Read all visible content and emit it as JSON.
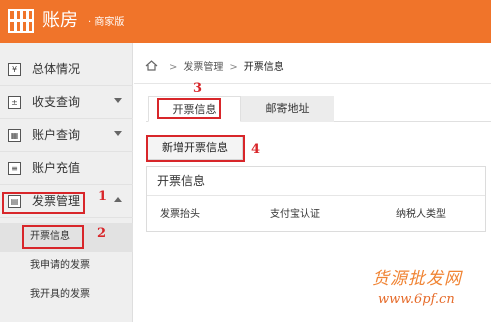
{
  "app": {
    "name": "账房",
    "sub": "· 商家版"
  },
  "sidebar": {
    "items": [
      {
        "label": "总体情况"
      },
      {
        "label": "收支查询"
      },
      {
        "label": "账户查询"
      },
      {
        "label": "账户充值"
      },
      {
        "label": "发票管理"
      }
    ],
    "subitems": [
      {
        "label": "开票信息"
      },
      {
        "label": "我申请的发票"
      },
      {
        "label": "我开具的发票"
      }
    ]
  },
  "breadcrumb": {
    "level1": "发票管理",
    "separator": ">",
    "current": "开票信息"
  },
  "tabs": [
    {
      "label": "开票信息"
    },
    {
      "label": "邮寄地址"
    }
  ],
  "actions": {
    "add_invoice": "新增开票信息"
  },
  "panel": {
    "title": "开票信息",
    "columns": [
      "发票抬头",
      "支付宝认证",
      "纳税人类型"
    ]
  },
  "annotations": [
    "1",
    "2",
    "3",
    "4"
  ],
  "watermark": {
    "text": "货源批发网",
    "url": "www.6pf.cn"
  },
  "colors": {
    "brand": "#f0742a",
    "annotation": "#d8262a"
  }
}
